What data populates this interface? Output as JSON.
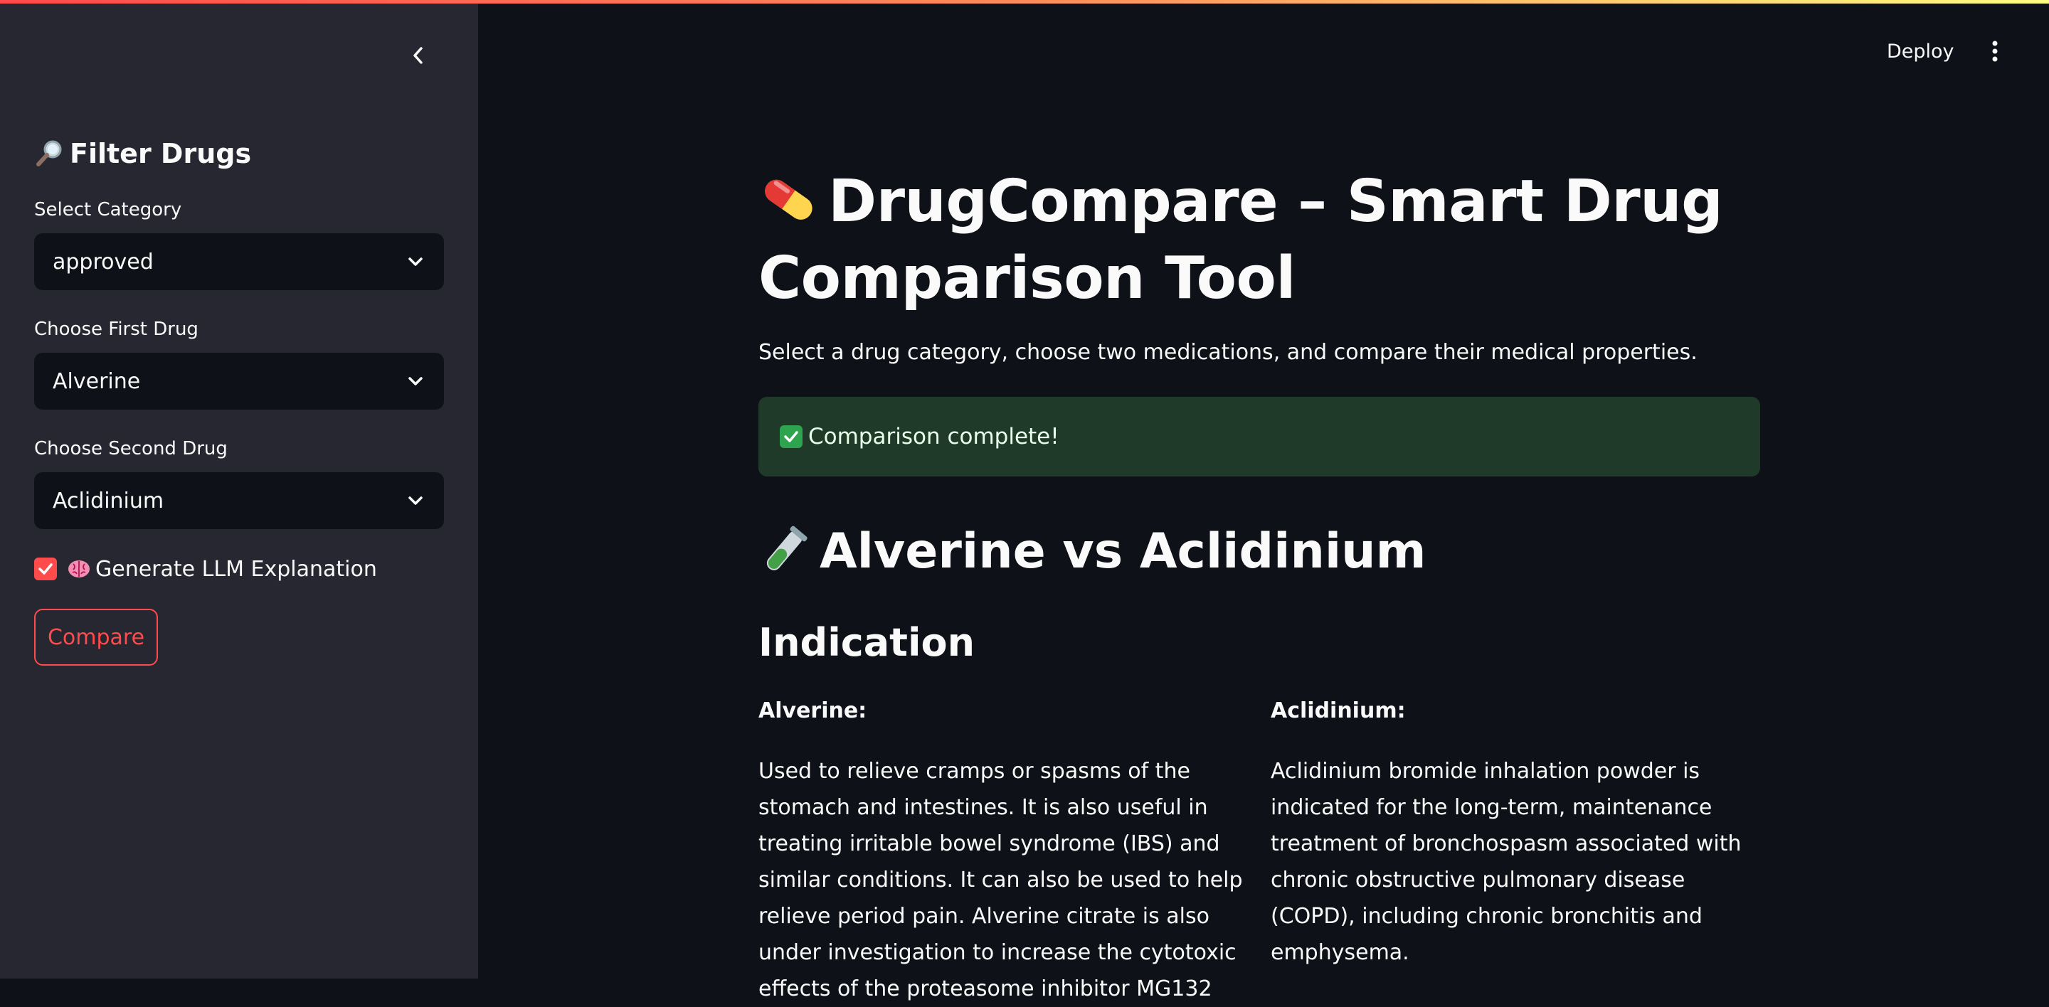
{
  "sidebar": {
    "title": "Filter Drugs",
    "category": {
      "label": "Select Category",
      "value": "approved"
    },
    "first_drug": {
      "label": "Choose First Drug",
      "value": "Alverine"
    },
    "second_drug": {
      "label": "Choose Second Drug",
      "value": "Aclidinium"
    },
    "llm_checkbox": {
      "label": "Generate LLM Explanation",
      "checked": true
    },
    "compare_label": "Compare"
  },
  "header": {
    "deploy_label": "Deploy"
  },
  "main": {
    "title": "DrugCompare – Smart Drug Comparison Tool",
    "subtitle": "Select a drug category, choose two medications, and compare their medical properties.",
    "success_message": "Comparison complete!",
    "comparison_heading": "Alverine vs Aclidinium",
    "section_heading": "Indication",
    "left": {
      "name": "Alverine:",
      "text": "Used to relieve cramps or spasms of the stomach and intestines. It is also useful in treating irritable bowel syndrome (IBS) and similar conditions. It can also be used to help relieve period pain. Alverine citrate is also under investigation to increase the cytotoxic effects of the proteasome inhibitor MG132"
    },
    "right": {
      "name": "Aclidinium:",
      "text": "Aclidinium bromide inhalation powder is indicated for the long-term, maintenance treatment of bronchospasm associated with chronic obstructive pulmonary disease (COPD), including chronic bronchitis and emphysema."
    }
  },
  "colors": {
    "accent": "#ff4b4b",
    "background": "#0e1117",
    "sidebar": "#262730",
    "success_bg": "#1f3a29"
  }
}
